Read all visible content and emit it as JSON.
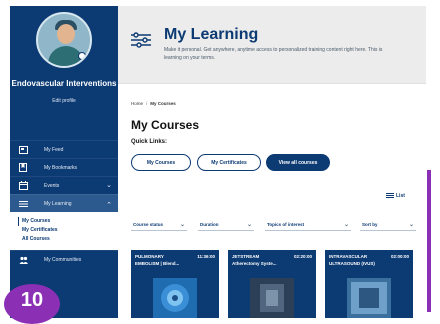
{
  "profile": {
    "name": "Endovascular Interventions",
    "edit_label": "Edit profile"
  },
  "nav": {
    "items": [
      {
        "label": "My Feed",
        "icon": "feed-icon"
      },
      {
        "label": "My Bookmarks",
        "icon": "bookmark-icon"
      },
      {
        "label": "Events",
        "icon": "calendar-icon"
      },
      {
        "label": "My Learning",
        "icon": "learning-icon"
      }
    ],
    "learning_sub": [
      "My Courses",
      "My Certificates",
      "All Courses"
    ],
    "communities": "My Communities"
  },
  "hero": {
    "title": "My Learning",
    "description": "Make it personal. Get anywhere, anytime access to personalized training content right here. This is learning on your terms."
  },
  "breadcrumb": {
    "home": "Home",
    "sep": "/",
    "current": "My Courses"
  },
  "page_title": "My Courses",
  "quick_links": {
    "label": "Quick Links:",
    "buttons": [
      "My Courses",
      "My Certificates",
      "View all courses"
    ]
  },
  "view_toggle": "List",
  "filters": [
    "Course status",
    "Duration",
    "Topics of interest",
    "Sort by"
  ],
  "cards": [
    {
      "line1": "PULMONARY",
      "line2": "EMBOLISM | Blend...",
      "duration": "11:36:00"
    },
    {
      "line1": "JETSTREAM",
      "line2": "Atherectomy Syste...",
      "duration": "02:20:00"
    },
    {
      "line1": "INTRAVASCULAR",
      "line2": "ULTRASOUND (IVUS)",
      "duration": "02:00:00"
    }
  ],
  "step_badge": "10",
  "colors": {
    "brand_navy": "#0c3a73",
    "accent_purple": "#8b2fb5"
  }
}
